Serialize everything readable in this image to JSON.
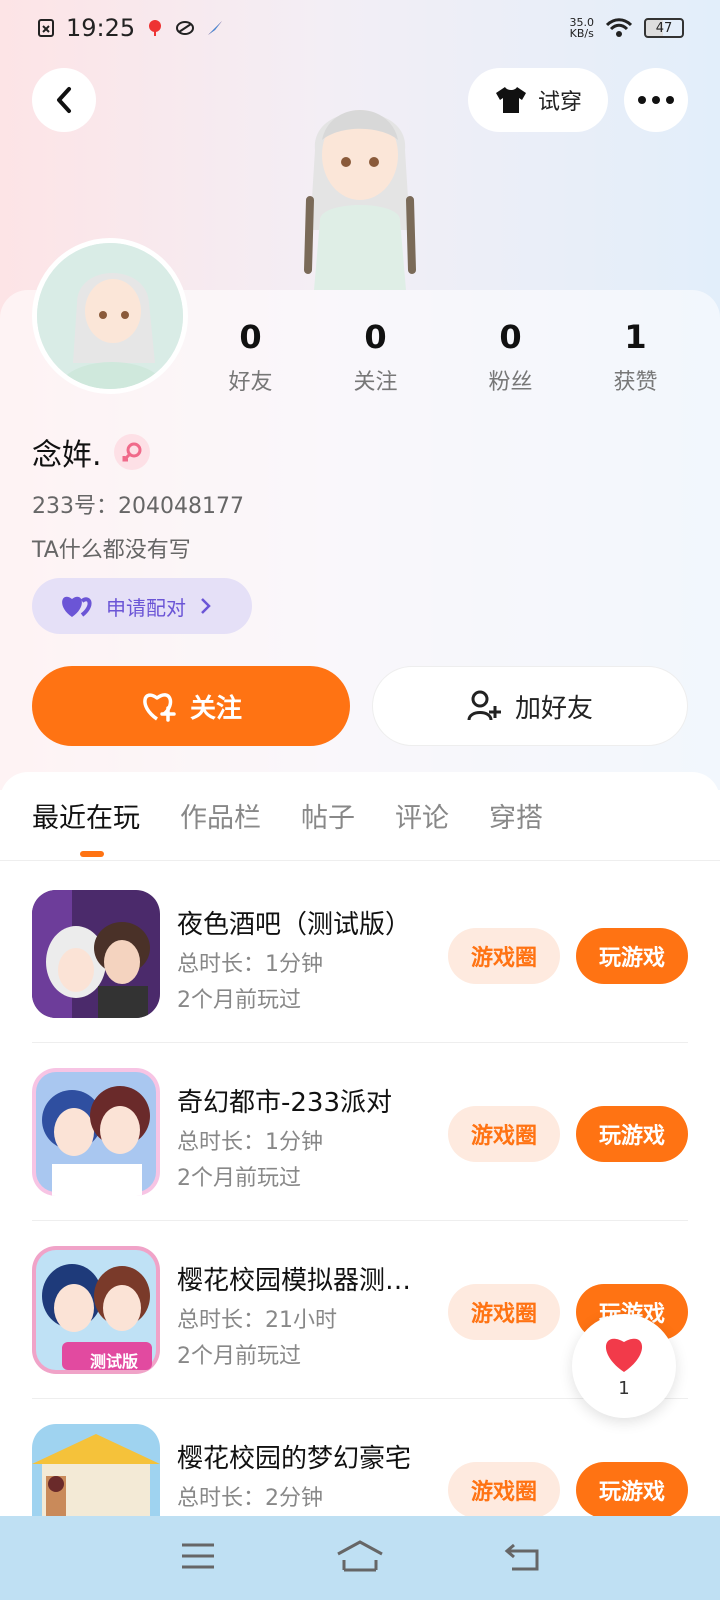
{
  "status_bar": {
    "time": "19:25",
    "net_speed_value": "35.0",
    "net_speed_unit": "KB/s",
    "battery": "47"
  },
  "header": {
    "try_on_label": "试穿"
  },
  "profile": {
    "stats": [
      {
        "count": "0",
        "label": "好友"
      },
      {
        "count": "0",
        "label": "关注"
      },
      {
        "count": "0",
        "label": "粉丝"
      },
      {
        "count": "1",
        "label": "获赞"
      }
    ],
    "name": "念姩.",
    "uid": "233号：204048177",
    "bio": "TA什么都没有写",
    "match_label": "申请配对",
    "follow_label": "关注",
    "add_friend_label": "加好友"
  },
  "tabs": [
    "最近在玩",
    "作品栏",
    "帖子",
    "评论",
    "穿搭"
  ],
  "games": [
    {
      "title": "夜色酒吧（测试版）",
      "duration": "总时长：1分钟",
      "last_played": "2个月前玩过",
      "circle_label": "游戏圈",
      "play_label": "玩游戏"
    },
    {
      "title": "奇幻都市-233派对",
      "duration": "总时长：1分钟",
      "last_played": "2个月前玩过",
      "circle_label": "游戏圈",
      "play_label": "玩游戏"
    },
    {
      "title": "樱花校园模拟器测…",
      "duration": "总时长：21小时",
      "last_played": "2个月前玩过",
      "circle_label": "游戏圈",
      "play_label": "玩游戏"
    },
    {
      "title": "樱花校园的梦幻豪宅",
      "duration": "总时长：2分钟",
      "last_played": "",
      "circle_label": "游戏圈",
      "play_label": "玩游戏"
    }
  ],
  "game3_badge": "测试版",
  "like_bubble": {
    "count": "1"
  },
  "colors": {
    "accent": "#ff7313",
    "match": "#6b55d6"
  }
}
